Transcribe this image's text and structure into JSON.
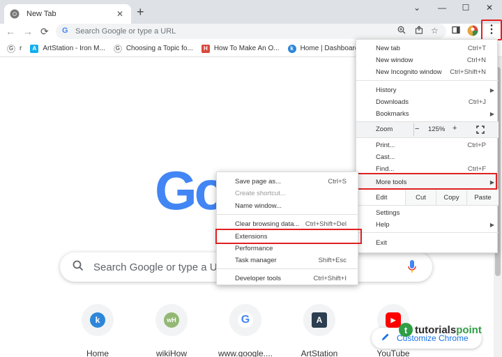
{
  "window": {
    "tab_title": "New Tab",
    "controls": {
      "collapse": "⌄",
      "minimize": "—",
      "maximize": "☐",
      "close": "✕"
    }
  },
  "toolbar": {
    "omnibox_placeholder": "Search Google or type a URL",
    "back": "←",
    "forward": "→",
    "reload": "⟳"
  },
  "bookmarks": [
    {
      "label": "r",
      "icon": "google-icon"
    },
    {
      "label": "ArtStation - Iron M...",
      "icon": "artstation-icon"
    },
    {
      "label": "Choosing a Topic fo...",
      "icon": "google-icon"
    },
    {
      "label": "How To Make An O...",
      "icon": "hubpages-icon"
    },
    {
      "label": "Home | Dashboard",
      "icon": "k-icon"
    }
  ],
  "page": {
    "logo_text": "Goo",
    "search_placeholder": "Search Google or type a U",
    "tiles": [
      {
        "label": "Home",
        "icon": "k-icon"
      },
      {
        "label": "wikiHow",
        "icon": "wikihow-icon"
      },
      {
        "label": "www.google....",
        "icon": "google-icon"
      },
      {
        "label": "ArtStation",
        "icon": "artstation-icon"
      },
      {
        "label": "YouTube",
        "icon": "youtube-icon"
      }
    ],
    "customize_label": "Customize Chrome",
    "watermark": {
      "prefix": "tutorials",
      "suffix": "point"
    }
  },
  "menu": {
    "new_tab": {
      "label": "New tab",
      "shortcut": "Ctrl+T"
    },
    "new_window": {
      "label": "New window",
      "shortcut": "Ctrl+N"
    },
    "incognito": {
      "label": "New Incognito window",
      "shortcut": "Ctrl+Shift+N"
    },
    "history": {
      "label": "History"
    },
    "downloads": {
      "label": "Downloads",
      "shortcut": "Ctrl+J"
    },
    "bookmarks": {
      "label": "Bookmarks"
    },
    "zoom": {
      "label": "Zoom",
      "minus": "−",
      "value": "125%",
      "plus": "+"
    },
    "print": {
      "label": "Print...",
      "shortcut": "Ctrl+P"
    },
    "cast": {
      "label": "Cast..."
    },
    "find": {
      "label": "Find...",
      "shortcut": "Ctrl+F"
    },
    "more_tools": {
      "label": "More tools"
    },
    "edit": {
      "label": "Edit",
      "cut": "Cut",
      "copy": "Copy",
      "paste": "Paste"
    },
    "settings": {
      "label": "Settings"
    },
    "help": {
      "label": "Help"
    },
    "exit": {
      "label": "Exit"
    }
  },
  "submenu": {
    "save_page": {
      "label": "Save page as...",
      "shortcut": "Ctrl+S"
    },
    "create_shortcut": {
      "label": "Create shortcut..."
    },
    "name_window": {
      "label": "Name window..."
    },
    "clear_data": {
      "label": "Clear browsing data...",
      "shortcut": "Ctrl+Shift+Del"
    },
    "extensions": {
      "label": "Extensions"
    },
    "performance": {
      "label": "Performance"
    },
    "task_manager": {
      "label": "Task manager",
      "shortcut": "Shift+Esc"
    },
    "dev_tools": {
      "label": "Developer tools",
      "shortcut": "Ctrl+Shift+I"
    }
  },
  "colors": {
    "highlight_red": "#e02020",
    "google_blue": "#4285f4",
    "google_red": "#ea4335",
    "link_blue": "#1a73e8"
  }
}
